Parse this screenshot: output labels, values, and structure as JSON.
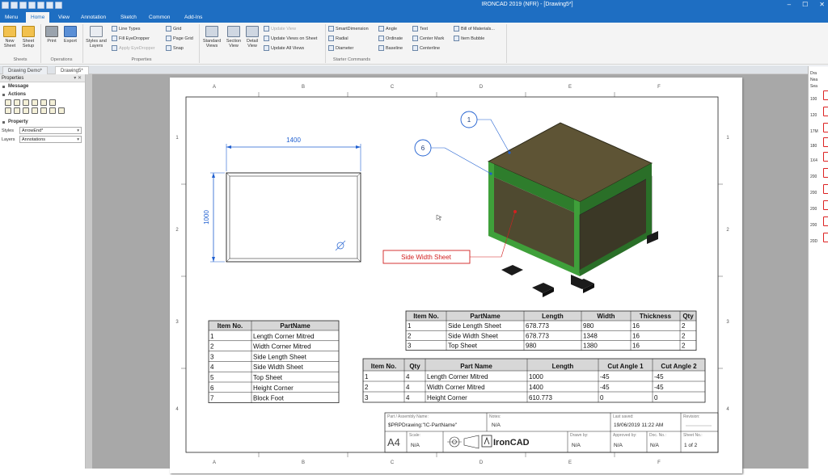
{
  "window": {
    "title": "IRONCAD 2019 (NFR) - [Drawing5*]",
    "controls": [
      "–",
      "☐",
      "✕"
    ]
  },
  "menu_tabs": [
    "Menu",
    "Home",
    "View",
    "Annotation",
    "Sketch",
    "Common",
    "Add-Ins"
  ],
  "ribbon": {
    "sheets": {
      "label": "Sheets",
      "new_sheet": "New Sheet",
      "sheet_setup": "Sheet Setup"
    },
    "operations": {
      "label": "Operations",
      "print": "Print",
      "export": "Export"
    },
    "properties": {
      "label": "Properties",
      "styles_layers": "Styles and Layers",
      "line_types": "Line Types",
      "fill_eyedropper": "Fill EyeDropper",
      "apply_eyedropper": "Apply EyeDropper",
      "grid": "Grid",
      "page_grid": "Page Grid",
      "snap": "Snap"
    },
    "views": {
      "standard_views": "Standard Views",
      "section_view": "Section View",
      "detail_view": "Detail View",
      "update_view": "Update View",
      "update_views_on_sheet": "Update Views on Sheet",
      "update_all_views": "Update All Views"
    },
    "starter": {
      "label": "Starter Commands",
      "smart_dimension": "SmartDimension",
      "radial": "Radial",
      "diameter": "Diameter",
      "angle": "Angle",
      "ordinate": "Ordinate",
      "baseline": "Baseline",
      "text": "Text",
      "center_mark": "Center Mark",
      "centerline": "Centerline",
      "bill_of_materials": "Bill of Materials...",
      "item_bubble": "Item Bubble"
    }
  },
  "doc_tabs": [
    "Drawing Demo*",
    "Drawing5*"
  ],
  "properties_panel": {
    "title": "Properties",
    "pin": "▾ ✕",
    "message": "Message",
    "actions": "Actions",
    "property": "Property",
    "styles_label": "Styles",
    "styles_value": "ArrowEnd*",
    "layers_label": "Layers",
    "layers_value": "Annotations"
  },
  "sheet": {
    "cols": [
      "A",
      "B",
      "C",
      "D",
      "E",
      "F"
    ],
    "rows": [
      "1",
      "2",
      "3",
      "4"
    ],
    "dim_width": "1400",
    "dim_height": "1000",
    "balloons": [
      "1",
      "6"
    ],
    "callout": "Side Width Sheet",
    "parts_table": {
      "headers": [
        "Item No.",
        "PartName"
      ],
      "rows": [
        [
          "1",
          "Length Corner Mitred"
        ],
        [
          "2",
          "Width Corner Mitred"
        ],
        [
          "3",
          "Side Length Sheet"
        ],
        [
          "4",
          "Side Width Sheet"
        ],
        [
          "5",
          "Top Sheet"
        ],
        [
          "6",
          "Height Corner"
        ],
        [
          "7",
          "Block Foot"
        ]
      ]
    },
    "sheet_table": {
      "headers": [
        "Item No.",
        "PartName",
        "Length",
        "Width",
        "Thickness",
        "Qty"
      ],
      "rows": [
        [
          "1",
          "Side Length Sheet",
          "678.773",
          "980",
          "16",
          "2"
        ],
        [
          "2",
          "Side Width Sheet",
          "678.773",
          "1348",
          "16",
          "2"
        ],
        [
          "3",
          "Top Sheet",
          "980",
          "1380",
          "16",
          "2"
        ]
      ]
    },
    "cut_table": {
      "headers": [
        "Item No.",
        "Qty",
        "Part Name",
        "Length",
        "Cut Angle 1",
        "Cut Angle 2"
      ],
      "rows": [
        [
          "1",
          "4",
          "Length Corner Mitred",
          "1000",
          "-45",
          "-45"
        ],
        [
          "2",
          "4",
          "Width Corner Mitred",
          "1400",
          "-45",
          "-45"
        ],
        [
          "3",
          "4",
          "Height Corner",
          "610.773",
          "0",
          "0"
        ]
      ]
    },
    "title_block": {
      "part_label": "Part / Assembly Name:",
      "part_value": "$PRPDrawing:\"IC-PartName\"",
      "notes_label": "Notes:",
      "notes_value": "N/A",
      "saved_label": "Last saved:",
      "saved_value": "19/06/2019 11:22 AM",
      "revision_label": "Revision:",
      "size": "A4",
      "scale_label": "Scale:",
      "scale_value": "N/A",
      "logo": "IronCAD",
      "drawn_label": "Drawn by:",
      "drawn_value": "N/A",
      "approved_label": "Approved by:",
      "approved_value": "N/A",
      "doc_label": "Doc. No.:",
      "doc_value": "N/A",
      "sheetno_label": "Sheet No.:",
      "sheetno_value": "1 of 2"
    }
  },
  "right_panel": {
    "items": [
      "Dra",
      "Nea",
      "Sea",
      "100",
      "120",
      "17M",
      "180",
      "1X4",
      "200",
      "200",
      "200",
      "200",
      "20D"
    ]
  },
  "colors": {
    "accent": "#1e6ec2",
    "dim_blue": "#1f5fd0",
    "callout_red": "#d22020",
    "crate_top": "#5e5435",
    "crate_green": "#3fa03a"
  }
}
